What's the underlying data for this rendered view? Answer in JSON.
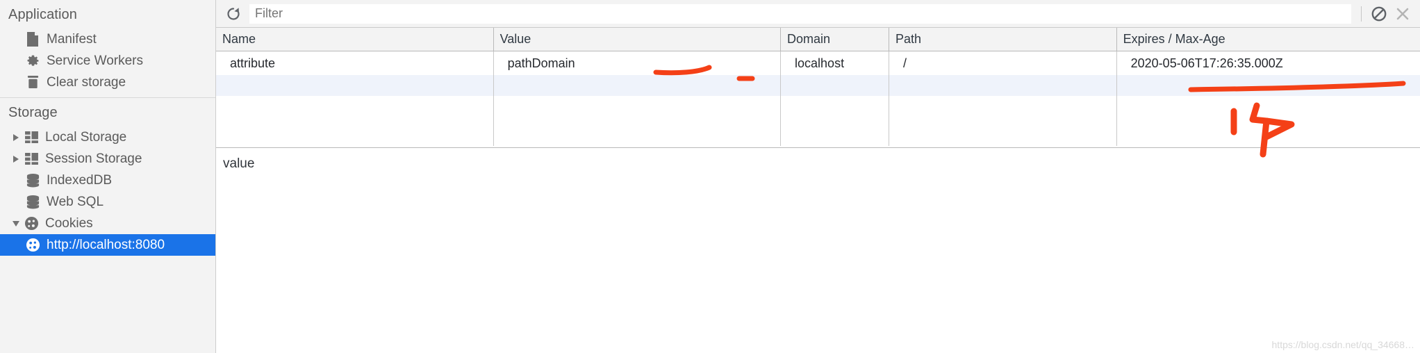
{
  "sidebar": {
    "application": {
      "title": "Application",
      "items": [
        {
          "label": "Manifest",
          "icon": "document-icon"
        },
        {
          "label": "Service Workers",
          "icon": "gear-icon"
        },
        {
          "label": "Clear storage",
          "icon": "trash-icon"
        }
      ]
    },
    "storage": {
      "title": "Storage",
      "items": [
        {
          "label": "Local Storage",
          "icon": "table-icon",
          "expandable": true,
          "expanded": false
        },
        {
          "label": "Session Storage",
          "icon": "table-icon",
          "expandable": true,
          "expanded": false
        },
        {
          "label": "IndexedDB",
          "icon": "database-icon",
          "expandable": false
        },
        {
          "label": "Web SQL",
          "icon": "database-icon",
          "expandable": false
        },
        {
          "label": "Cookies",
          "icon": "cookie-icon",
          "expandable": true,
          "expanded": true
        }
      ],
      "cookie_origin": {
        "label": "http://localhost:8080",
        "icon": "cookie-icon",
        "selected": true
      }
    }
  },
  "toolbar": {
    "refresh_label": "refresh-icon",
    "filter_placeholder": "Filter",
    "filter_value": "",
    "clear_label": "clear-icon",
    "close_label": "close-icon"
  },
  "table": {
    "columns": [
      "Name",
      "Value",
      "Domain",
      "Path",
      "Expires / Max-Age"
    ],
    "rows": [
      {
        "name": "attribute",
        "value": "pathDomain",
        "domain": "localhost",
        "path": "/",
        "expires": "2020-05-06T17:26:35.000Z"
      }
    ]
  },
  "detail": {
    "text": "value"
  },
  "annotations": {
    "underline_color": "#f44017",
    "marks": [
      {
        "name": "underline-domain",
        "target": "localhost"
      },
      {
        "name": "underline-path",
        "target": "/"
      },
      {
        "name": "underline-expires",
        "target": "2020-05-06T17:26:35.000Z"
      },
      {
        "name": "handwritten-mark",
        "target": "expires-cell"
      }
    ]
  },
  "watermark": {
    "text": "https://blog.csdn.net/qq_34668…"
  },
  "colors": {
    "selection_blue": "#1a73e8",
    "panel_bg": "#f3f3f3",
    "annotation_red": "#f44017",
    "row_alt": "#eff3fb"
  }
}
